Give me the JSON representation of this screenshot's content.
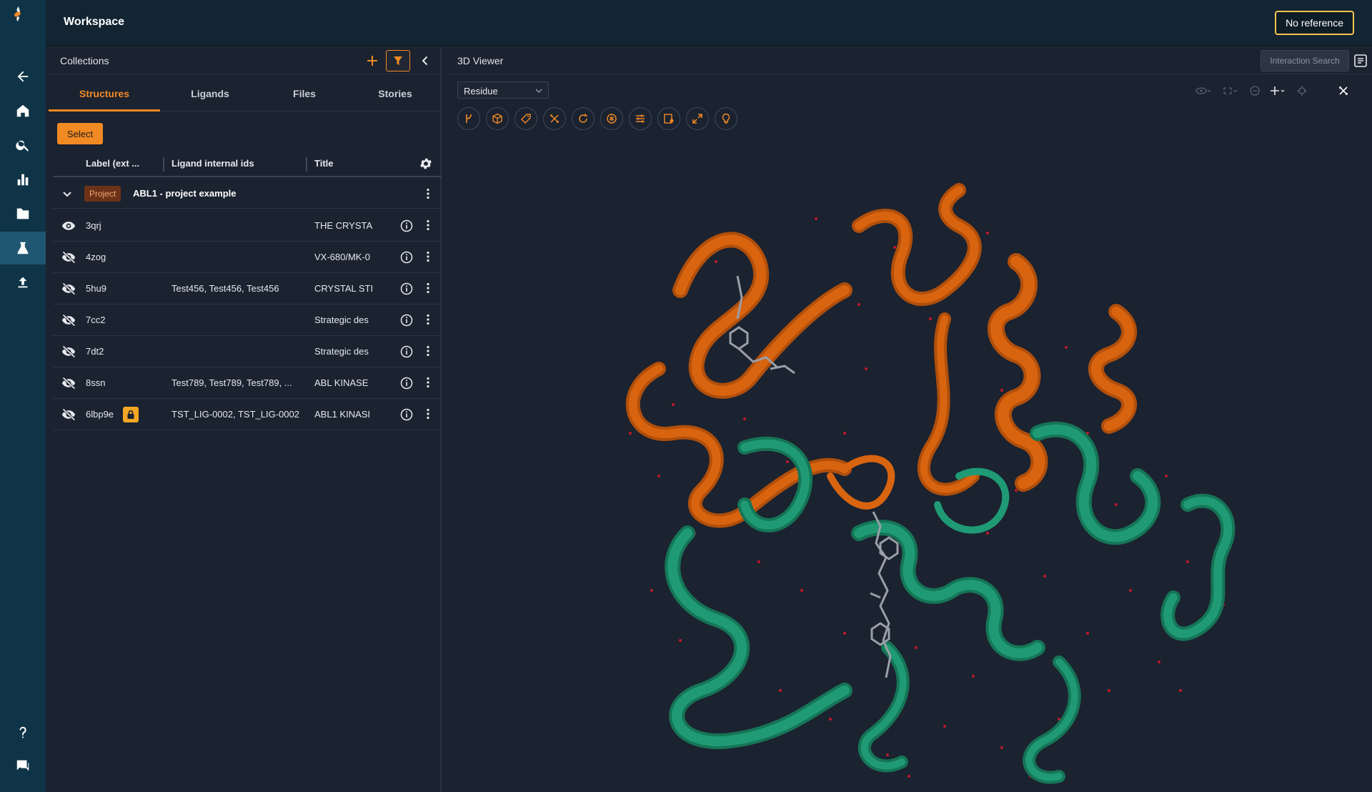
{
  "header": {
    "title": "Workspace",
    "reference_button": "No reference"
  },
  "rail": {
    "items": [
      {
        "icon": "back-arrow-icon"
      },
      {
        "icon": "home-icon"
      },
      {
        "icon": "search-icon"
      },
      {
        "icon": "bar-chart-icon"
      },
      {
        "icon": "folder-icon"
      },
      {
        "icon": "flask-icon",
        "active": true
      },
      {
        "icon": "upload-icon"
      },
      {
        "icon": "help-icon"
      },
      {
        "icon": "chat-icon"
      }
    ]
  },
  "collections": {
    "title": "Collections",
    "tabs": [
      {
        "label": "Structures",
        "active": true
      },
      {
        "label": "Ligands"
      },
      {
        "label": "Files"
      },
      {
        "label": "Stories"
      }
    ],
    "select_label": "Select",
    "columns": [
      "Label (ext ...",
      "Ligand internal ids",
      "Title"
    ],
    "group": {
      "badge": "Project",
      "name": "ABL1 - project example"
    },
    "rows": [
      {
        "label": "3qrj",
        "ligands": "",
        "title": "THE CRYSTA",
        "visible": true
      },
      {
        "label": "4zog",
        "ligands": "",
        "title": "VX-680/MK-0",
        "visible": false
      },
      {
        "label": "5hu9",
        "ligands": "Test456, Test456, Test456",
        "title": "CRYSTAL STI",
        "visible": false
      },
      {
        "label": "7cc2",
        "ligands": "",
        "title": "Strategic des",
        "visible": false
      },
      {
        "label": "7dt2",
        "ligands": "",
        "title": "Strategic des",
        "visible": false
      },
      {
        "label": "8ssn",
        "ligands": "Test789, Test789, Test789, ...",
        "title": "ABL KINASE",
        "visible": false
      },
      {
        "label": "6lbp9e",
        "ligands": "TST_LIG-0002, TST_LIG-0002",
        "title": "ABL1 KINASI",
        "visible": false,
        "locked": true
      }
    ]
  },
  "viewer": {
    "title": "3D Viewer",
    "interaction_search": "Interaction Search",
    "mode": "Residue",
    "colors": {
      "chain_a": "#d9640f",
      "chain_b": "#1f9a74",
      "ligand": "#9a9fa8",
      "water": "#c0182a",
      "accent": "#f28a24"
    }
  }
}
